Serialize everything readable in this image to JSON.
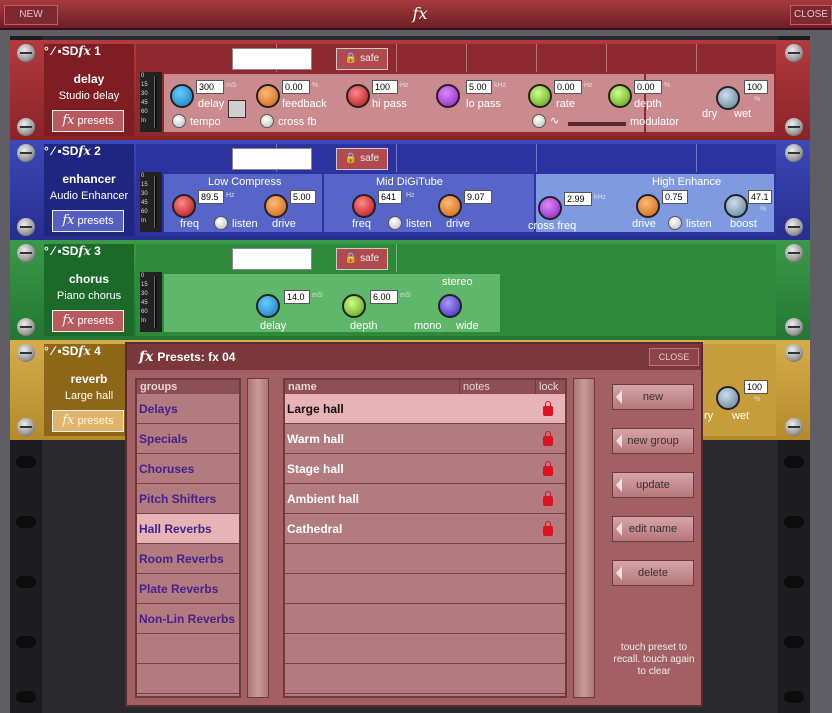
{
  "topbar": {
    "new_label": "NEW",
    "title": "fx",
    "close_label": "CLOSE"
  },
  "units": [
    {
      "num": "1",
      "type": "delay",
      "desc": "Studio delay",
      "presets_label": "presets",
      "safe_label": "safe",
      "color": "#a32a30",
      "controls": {
        "delay": "300",
        "delay_unit": "mS",
        "delay_label": "delay",
        "tempo": "tempo",
        "feedback": "0.00",
        "feedback_unit": "%",
        "feedback_label": "feedback",
        "crossfb": "cross fb",
        "hipass": "100",
        "hipass_unit": "Hz",
        "hipass_label": "hi pass",
        "lopass": "5.00",
        "lopass_unit": "kHz",
        "lopass_label": "lo pass",
        "rate": "0.00",
        "rate_unit": "Hz",
        "rate_label": "rate",
        "depth": "0.00",
        "depth_unit": "%",
        "depth_label": "depth",
        "modulator": "modulator",
        "wet": "100",
        "wet_unit": "%",
        "dry_label": "dry",
        "wet_label": "wet"
      }
    },
    {
      "num": "2",
      "type": "enhancer",
      "desc": "Audio Enhancer",
      "presets_label": "presets",
      "safe_label": "safe",
      "color": "#2f3aa6",
      "controls": {
        "sec1": "Low Compress",
        "freq1": "89.5",
        "freq1_unit": "Hz",
        "drive1": "5.00",
        "freq_label": "freq",
        "listen_label": "listen",
        "drive_label": "drive",
        "sec2": "Mid DiGiTube",
        "freq2": "641",
        "freq2_unit": "Hz",
        "drive2": "9.07",
        "sec3": "High Enhance",
        "crossfreq": "2.99",
        "crossfreq_unit": "kHz",
        "crossfreq_label": "cross freq",
        "drive3": "0.75",
        "boost": "47.1",
        "boost_unit": "%",
        "boost_label": "boost"
      }
    },
    {
      "num": "3",
      "type": "chorus",
      "desc": "Piano chorus",
      "presets_label": "presets",
      "safe_label": "safe",
      "color": "#2f8a3e",
      "controls": {
        "delay": "14.0",
        "delay_unit": "mS",
        "delay_label": "delay",
        "depth": "6.00",
        "depth_unit": "mS",
        "depth_label": "depth",
        "stereo_label": "stereo",
        "mono_label": "mono",
        "wide_label": "wide"
      }
    },
    {
      "num": "4",
      "type": "reverb",
      "desc": "Large hall",
      "presets_label": "presets",
      "color": "#c9a040",
      "controls": {
        "wet": "100",
        "wet_unit": "%",
        "dry_label": "ry",
        "wet_label": "wet"
      }
    }
  ],
  "meter_ticks": [
    "0",
    "15",
    "30",
    "45",
    "60",
    "In"
  ],
  "presets_dialog": {
    "title": "Presets: fx 04",
    "close_label": "CLOSE",
    "groups_header": "groups",
    "groups": [
      "Delays",
      "Specials",
      "Choruses",
      "Pitch Shifters",
      "Hall Reverbs",
      "Room Reverbs",
      "Plate Reverbs",
      "Non-Lin Reverbs"
    ],
    "selected_group": "Hall Reverbs",
    "cols": {
      "name": "name",
      "notes": "notes",
      "lock": "lock"
    },
    "presets": [
      "Large hall",
      "Warm hall",
      "Stage hall",
      "Ambient hall",
      "Cathedral"
    ],
    "selected_preset": "Large hall",
    "actions": [
      "new",
      "new group",
      "update",
      "edit name",
      "delete"
    ],
    "hint": "touch preset to recall. touch again to clear"
  }
}
